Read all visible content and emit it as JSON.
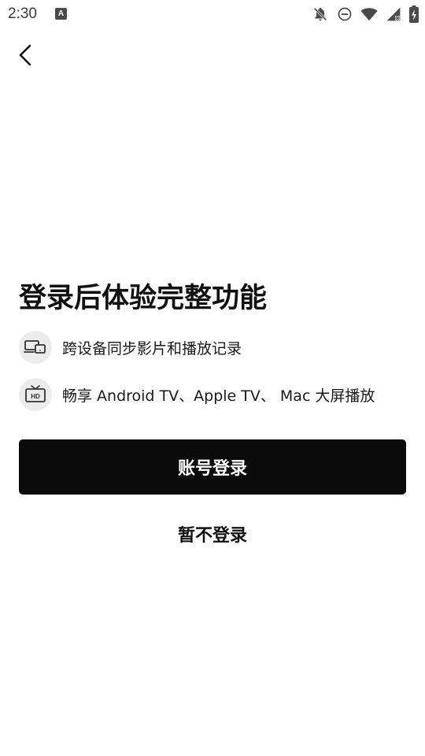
{
  "status_bar": {
    "time": "2:30",
    "app_icon_letter": "A",
    "icon_color": "#4a4a4a"
  },
  "login_prompt": {
    "headline": "登录后体验完整功能",
    "features": [
      {
        "icon": "multi-device-sync-icon",
        "text": "跨设备同步影片和播放记录"
      },
      {
        "icon": "hd-tv-icon",
        "text": "畅享 Android TV、Apple TV、 Mac 大屏播放"
      }
    ],
    "primary_button_label": "账号登录",
    "secondary_button_label": "暂不登录"
  },
  "colors": {
    "primary_button_bg": "#0b0b0b",
    "primary_button_text": "#ffffff",
    "feature_icon_bg": "#ececec",
    "text": "#111111"
  }
}
